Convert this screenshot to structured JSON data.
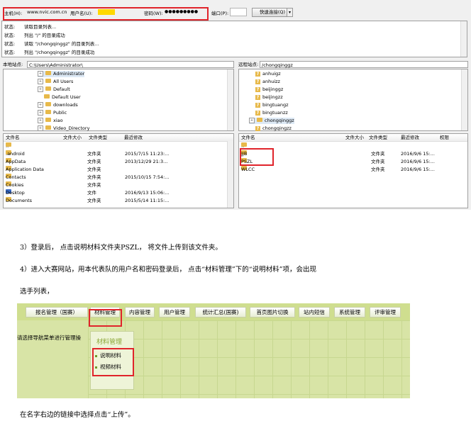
{
  "quickconnect": {
    "host_label": "主机(H):",
    "host_value": "www.nvic.com.cn",
    "user_label": "用户名(U):",
    "pass_label": "密码(W):",
    "pass_value": "●●●●●●●●●",
    "port_label": "端口(P):",
    "connect_button": "快速连接(Q)"
  },
  "log": [
    {
      "status": "状态:",
      "text": "读取目录列表..."
    },
    {
      "status": "状态:",
      "text": "列出 \"/\" 的目录成功"
    },
    {
      "status": "状态:",
      "text": "读取 \"/chongqinggz\" 的目录列表..."
    },
    {
      "status": "状态:",
      "text": "列出 \"/chongqinggz\" 的目录成功"
    }
  ],
  "local": {
    "site_label": "本地站点:",
    "path": "C:\\Users\\Administrator\\",
    "tree": [
      "Administrator",
      "All Users",
      "Default",
      "Default User",
      "downloads",
      "Public",
      "xiao",
      "Video_Directory"
    ],
    "columns": [
      "文件名",
      "文件大小",
      "文件类型",
      "最近修改"
    ],
    "files": [
      {
        "name": "..",
        "type": "",
        "modified": ""
      },
      {
        "name": ".android",
        "type": "文件夹",
        "modified": "2015/7/15 11:23:..."
      },
      {
        "name": "AppData",
        "type": "文件夹",
        "modified": "2013/12/29 21:3..."
      },
      {
        "name": "Application Data",
        "type": "文件夹",
        "modified": ""
      },
      {
        "name": "Contacts",
        "type": "文件夹",
        "modified": "2015/10/15 7:54:..."
      },
      {
        "name": "Cookies",
        "type": "文件夹",
        "modified": ""
      },
      {
        "name": "Desktop",
        "type": "文件",
        "modified": "2016/9/13 15:06:..."
      },
      {
        "name": "Documents",
        "type": "文件夹",
        "modified": "2015/5/14 11:15:..."
      }
    ]
  },
  "remote": {
    "site_label": "远程站点:",
    "path": "/chongqinggz",
    "tree": [
      "anhuigz",
      "anhuizz",
      "beijinggz",
      "beijingzz",
      "bingtuangz",
      "bingtuanzz",
      "chongqinggz",
      "chongqingzz"
    ],
    "columns": [
      "文件名",
      "文件大小",
      "文件类型",
      "最近修改",
      "权限"
    ],
    "files": [
      {
        "name": "..",
        "type": "",
        "modified": ""
      },
      {
        "name": "JJB",
        "type": "文件夹",
        "modified": "2016/9/6 15:..."
      },
      {
        "name": "PSZL",
        "type": "文件夹",
        "modified": "2016/9/6 15:..."
      },
      {
        "name": "WLCC",
        "type": "文件夹",
        "modified": "2016/9/6 15:..."
      }
    ]
  },
  "doc": {
    "step3": "3）登录后， 点击说明材料文件夹PSZL， 将文件上传到该文件夹。",
    "step4": "4）进入大赛网站，用本代表队的用户名和密码登录后， 点击“材料管理”下的“说明材料”项，会出现",
    "step4b": "选手列表，",
    "final": "在名字右边的链接中选择点击“上传”。"
  },
  "menu": {
    "items": [
      "报名管理（国赛）",
      "材料管理",
      "内容管理",
      "用户管理",
      "统计汇总(国赛)",
      "首页图片切换",
      "站内短信",
      "系统管理",
      "评审管理"
    ],
    "hint": "请选择导航菜单进行管理操",
    "dropdown_title": "材料管理",
    "dropdown_items": [
      "说明材料",
      "视频材料"
    ]
  }
}
